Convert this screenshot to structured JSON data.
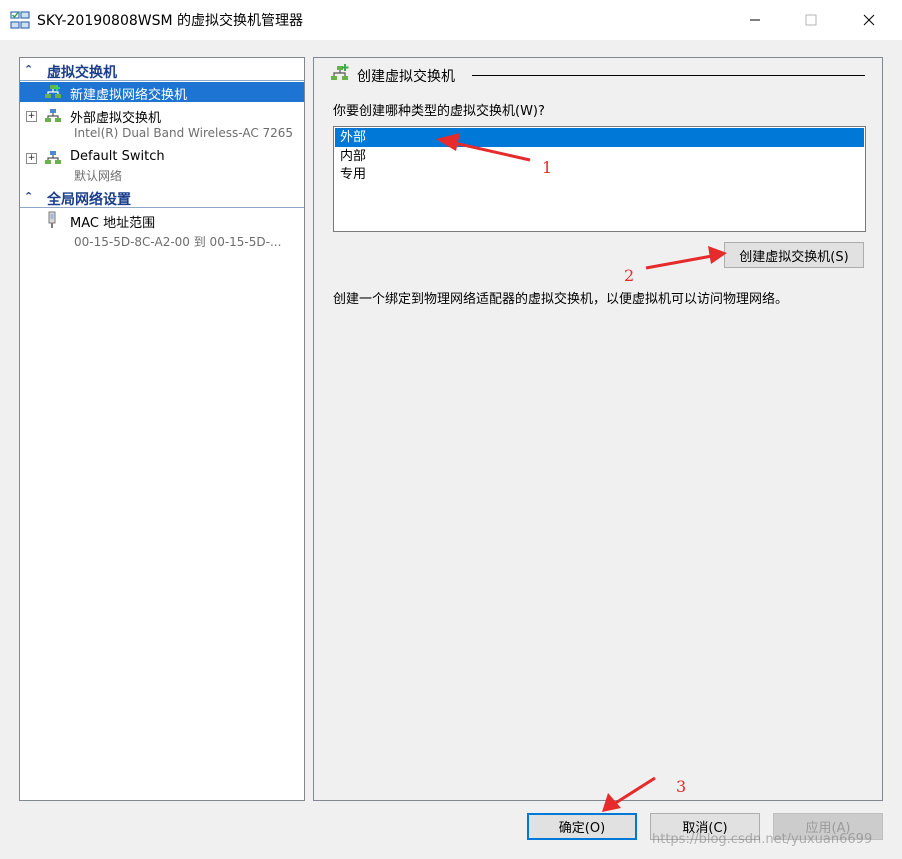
{
  "window": {
    "title": "SKY-20190808WSM 的虚拟交换机管理器",
    "controls": {
      "minimize": "—",
      "maximize": "☐",
      "close": "✕"
    }
  },
  "sidebar": {
    "section_switches": "虚拟交换机",
    "items": [
      {
        "label": "新建虚拟网络交换机",
        "subtitle": ""
      },
      {
        "label": "外部虚拟交换机",
        "subtitle": "Intel(R) Dual Band Wireless-AC 7265"
      },
      {
        "label": "Default Switch",
        "subtitle": "默认网络"
      }
    ],
    "section_global": "全局网络设置",
    "global_items": [
      {
        "label": "MAC 地址范围",
        "subtitle": "00-15-5D-8C-A2-00 到 00-15-5D-..."
      }
    ]
  },
  "main": {
    "title": "创建虚拟交换机",
    "question": "你要创建哪种类型的虚拟交换机(W)?",
    "options": [
      "外部",
      "内部",
      "专用"
    ],
    "selected_option": "外部",
    "create_button": "创建虚拟交换机(S)",
    "description": "创建一个绑定到物理网络适配器的虚拟交换机，以便虚拟机可以访问物理网络。"
  },
  "footer": {
    "ok_label": "确定(O)",
    "cancel_label": "取消(C)",
    "apply_label": "应用(A)"
  },
  "annotations": [
    "1",
    "2",
    "3"
  ],
  "watermark": "https://blog.csdn.net/yuxuan6699",
  "colors": {
    "selection": "#1e74d3",
    "section_header": "#1a3e8c",
    "annotation": "#e52b2b",
    "default_button_border": "#0078d7"
  }
}
